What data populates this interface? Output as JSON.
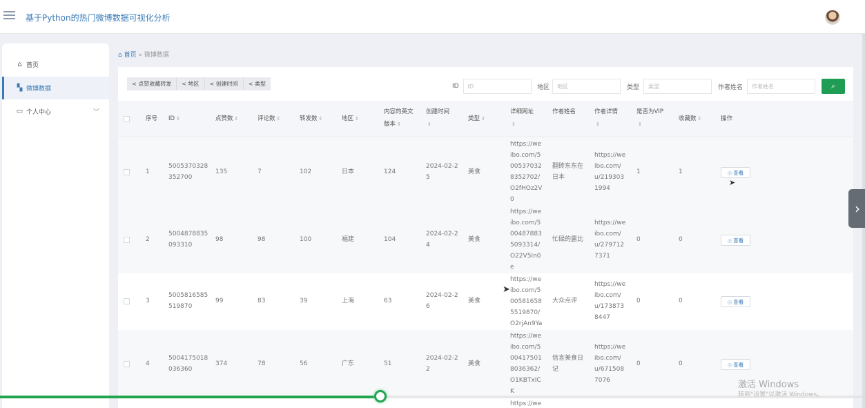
{
  "header": {
    "title": "基于Python的热门微博数据可视化分析"
  },
  "sidebar": {
    "items": [
      {
        "icon": "⌂",
        "label": "首页"
      },
      {
        "icon": "▚",
        "label": "微博数据"
      },
      {
        "icon": "▭",
        "label": "个人中心",
        "chevron": "﹀"
      }
    ]
  },
  "breadcrumb": {
    "home": "首页",
    "separator": "»",
    "current": "微博数据"
  },
  "toolbar": {
    "sort_buttons": [
      "点赞收藏转发",
      "地区",
      "创建时间",
      "类型"
    ],
    "filters": {
      "id_label": "ID",
      "id_placeholder": "ID",
      "region_label": "地区",
      "region_placeholder": "地区",
      "type_label": "类型",
      "type_placeholder": "类型",
      "author_label": "作者姓名",
      "author_placeholder": "作者姓名"
    },
    "search_icon": "⌕"
  },
  "table": {
    "headers": {
      "index": "序号",
      "id": "ID",
      "likes": "点赞数",
      "comments": "评论数",
      "reposts": "转发数",
      "region": "地区",
      "en_content": "内容的英文",
      "en_content2": "版本",
      "created": "创建时间",
      "type": "类型",
      "detail_url": "详细网址",
      "author": "作者姓名",
      "author_detail": "作者详情",
      "vip": "是否为VIP",
      "favorites": "收藏数",
      "actions": "操作"
    },
    "view_label": "查看",
    "rows": [
      {
        "index": "1",
        "id": [
          "5005370328",
          "352700"
        ],
        "likes": "135",
        "comments": "7",
        "reposts": "102",
        "region": "日本",
        "en": "124",
        "created": [
          "2024-02-2",
          "5"
        ],
        "type": "美食",
        "url": [
          "https://we",
          "ibo.com/5",
          "00537032",
          "8352702/",
          "O2fHOz2V",
          "0"
        ],
        "author": [
          "翻砖东东在",
          "日本"
        ],
        "author_url": [
          "https://we",
          "ibo.com/",
          "u/219303",
          "1994"
        ],
        "vip": "1",
        "favorites": "1"
      },
      {
        "index": "2",
        "id": [
          "5004878835",
          "093310"
        ],
        "likes": "98",
        "comments": "98",
        "reposts": "100",
        "region": "福建",
        "en": "104",
        "created": [
          "2024-02-2",
          "4"
        ],
        "type": "美食",
        "url": [
          "https://we",
          "ibo.com/5",
          "00487883",
          "5093314/",
          "O22V5In0",
          "e"
        ],
        "author": [
          "忙碌的露比"
        ],
        "author_url": [
          "https://we",
          "ibo.com/",
          "u/279712",
          "7371"
        ],
        "vip": "0",
        "favorites": "0"
      },
      {
        "index": "3",
        "id": [
          "5005816585",
          "519870"
        ],
        "likes": "99",
        "comments": "83",
        "reposts": "39",
        "region": "上海",
        "en": "63",
        "created": [
          "2024-02-2",
          "6"
        ],
        "type": "美食",
        "url": [
          "https://we",
          "ibo.com/5",
          "00581658",
          "5519870/",
          "O2rjAn9Ya"
        ],
        "author": [
          "大众点评"
        ],
        "author_url": [
          "https://we",
          "ibo.com/",
          "u/173873",
          "8447"
        ],
        "vip": "0",
        "favorites": "0"
      },
      {
        "index": "4",
        "id": [
          "5004175018",
          "036360"
        ],
        "likes": "374",
        "comments": "78",
        "reposts": "56",
        "region": "广东",
        "en": "51",
        "created": [
          "2024-02-2",
          "2"
        ],
        "type": "美食",
        "url": [
          "https://we",
          "ibo.com/5",
          "00417501",
          "8036362/",
          "O1KBTxIC",
          "K"
        ],
        "author": [
          "信言美食日",
          "记"
        ],
        "author_url": [
          "https://we",
          "ibo.com/",
          "u/671508",
          "7076"
        ],
        "vip": "0",
        "favorites": "0"
      }
    ],
    "partial_row_url": "https://we"
  },
  "video_player": {
    "progress": 0.44
  },
  "watermark": {
    "line1": "激活 Windows",
    "line2": "转到\"设置\"以激活 Windows。"
  },
  "colors": {
    "accent": "#3a7ab8",
    "search_button": "#1f9d55",
    "progress": "#21a44e"
  }
}
